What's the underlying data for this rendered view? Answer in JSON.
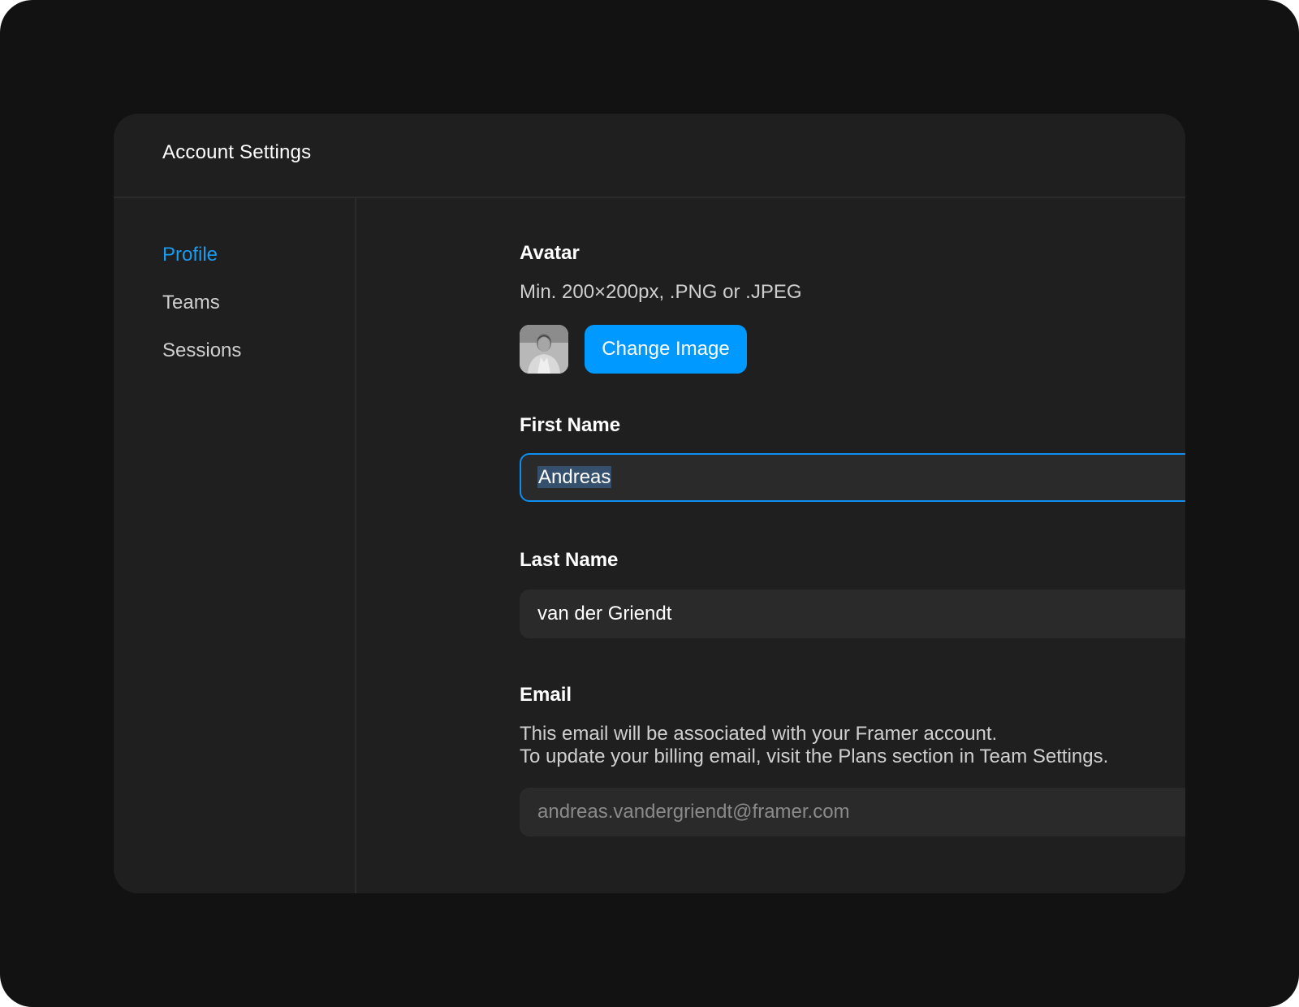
{
  "window": {
    "title": "Account Settings"
  },
  "sidebar": {
    "items": [
      {
        "label": "Profile",
        "active": true
      },
      {
        "label": "Teams",
        "active": false
      },
      {
        "label": "Sessions",
        "active": false
      }
    ]
  },
  "avatar": {
    "label": "Avatar",
    "help": "Min. 200×200px, .PNG or .JPEG",
    "button_label": "Change Image"
  },
  "first_name": {
    "label": "First Name",
    "value": "Andreas"
  },
  "last_name": {
    "label": "Last Name",
    "value": "van der Griendt"
  },
  "email": {
    "label": "Email",
    "help_line1": "This email will be associated with your Framer account.",
    "help_line2": "To update your billing email, visit the Plans section in Team Settings.",
    "value": "andreas.vandergriendt@framer.com"
  },
  "colors": {
    "accent": "#0099ff",
    "active_nav": "#1a9bf0",
    "background": "#121212",
    "panel": "#1f1f1f",
    "input": "#2a2a2a"
  }
}
